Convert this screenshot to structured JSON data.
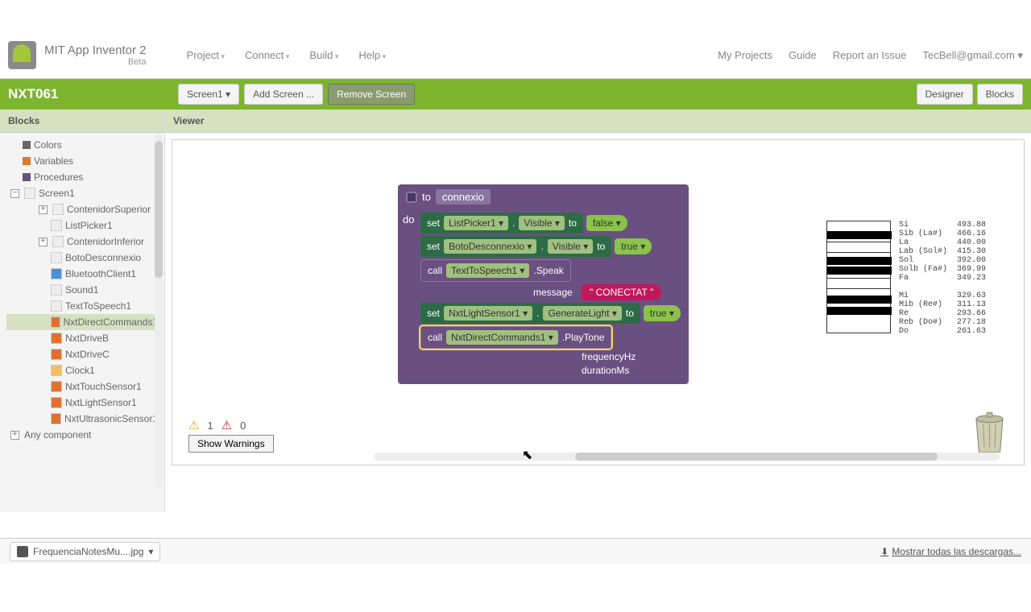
{
  "brand": {
    "title": "MIT App Inventor 2",
    "beta": "Beta"
  },
  "menu": {
    "project": "Project",
    "connect": "Connect",
    "build": "Build",
    "help": "Help"
  },
  "rmenu": {
    "myprojects": "My Projects",
    "guide": "Guide",
    "report": "Report an Issue",
    "user": "TecBell@gmail.com ▾"
  },
  "greenbar": {
    "project": "NXT061",
    "screen": "Screen1 ▾",
    "addscreen": "Add Screen ...",
    "removescreen": "Remove Screen",
    "designer": "Designer",
    "blocks": "Blocks"
  },
  "sidebar": {
    "header": "Blocks"
  },
  "tree": {
    "colors": "Colors",
    "variables": "Variables",
    "procedures": "Procedures",
    "screen1": "Screen1",
    "contsup": "ContenidorSuperior",
    "listpicker": "ListPicker1",
    "continf": "ContenidorInferior",
    "botodes": "BotoDesconnexio",
    "bt": "BluetoothClient1",
    "sound": "Sound1",
    "tts": "TextToSpeech1",
    "nxtdc": "NxtDirectCommands1",
    "drvb": "NxtDriveB",
    "drvc": "NxtDriveC",
    "clock": "Clock1",
    "touch": "NxtTouchSensor1",
    "light": "NxtLightSensor1",
    "ultra": "NxtUltrasonicSensor1",
    "anycomp": "Any component"
  },
  "viewer": {
    "header": "Viewer"
  },
  "blocks": {
    "to": "to",
    "procname": "connexio",
    "do": "do",
    "set": "set",
    "call": "call",
    "toKw": "to",
    "lp": "ListPicker1 ▾",
    "visible": "Visible ▾",
    "false": "false ▾",
    "boto": "BotoDesconnexio ▾",
    "true": "true ▾",
    "tts": "TextToSpeech1 ▾",
    "speak": ".Speak",
    "message": "message",
    "conectat": "\" CONECTAT \"",
    "nls": "NxtLightSensor1 ▾",
    "genlight": "GenerateLight ▾",
    "ndc": "NxtDirectCommands1 ▾",
    "playtone": ".PlayTone",
    "freq": "frequencyHz",
    "dur": "durationMs"
  },
  "freqtable": "Si          493.88\nSib (La#)   466.16\nLa          440.00\nLab (Sol#)  415.30\nSol         392.00\nSolb (Fa#)  369.99\nFa          349.23\n\nMi          329.63\nMib (Re#)   311.13\nRe          293.66\nReb (Do#)   277.18\nDo          261.63",
  "warnings": {
    "warn": "1",
    "err": "0",
    "show": "Show Warnings"
  },
  "download": {
    "file": "FrequenciaNotesMu....jpg",
    "all": "Mostrar todas las descargas..."
  }
}
